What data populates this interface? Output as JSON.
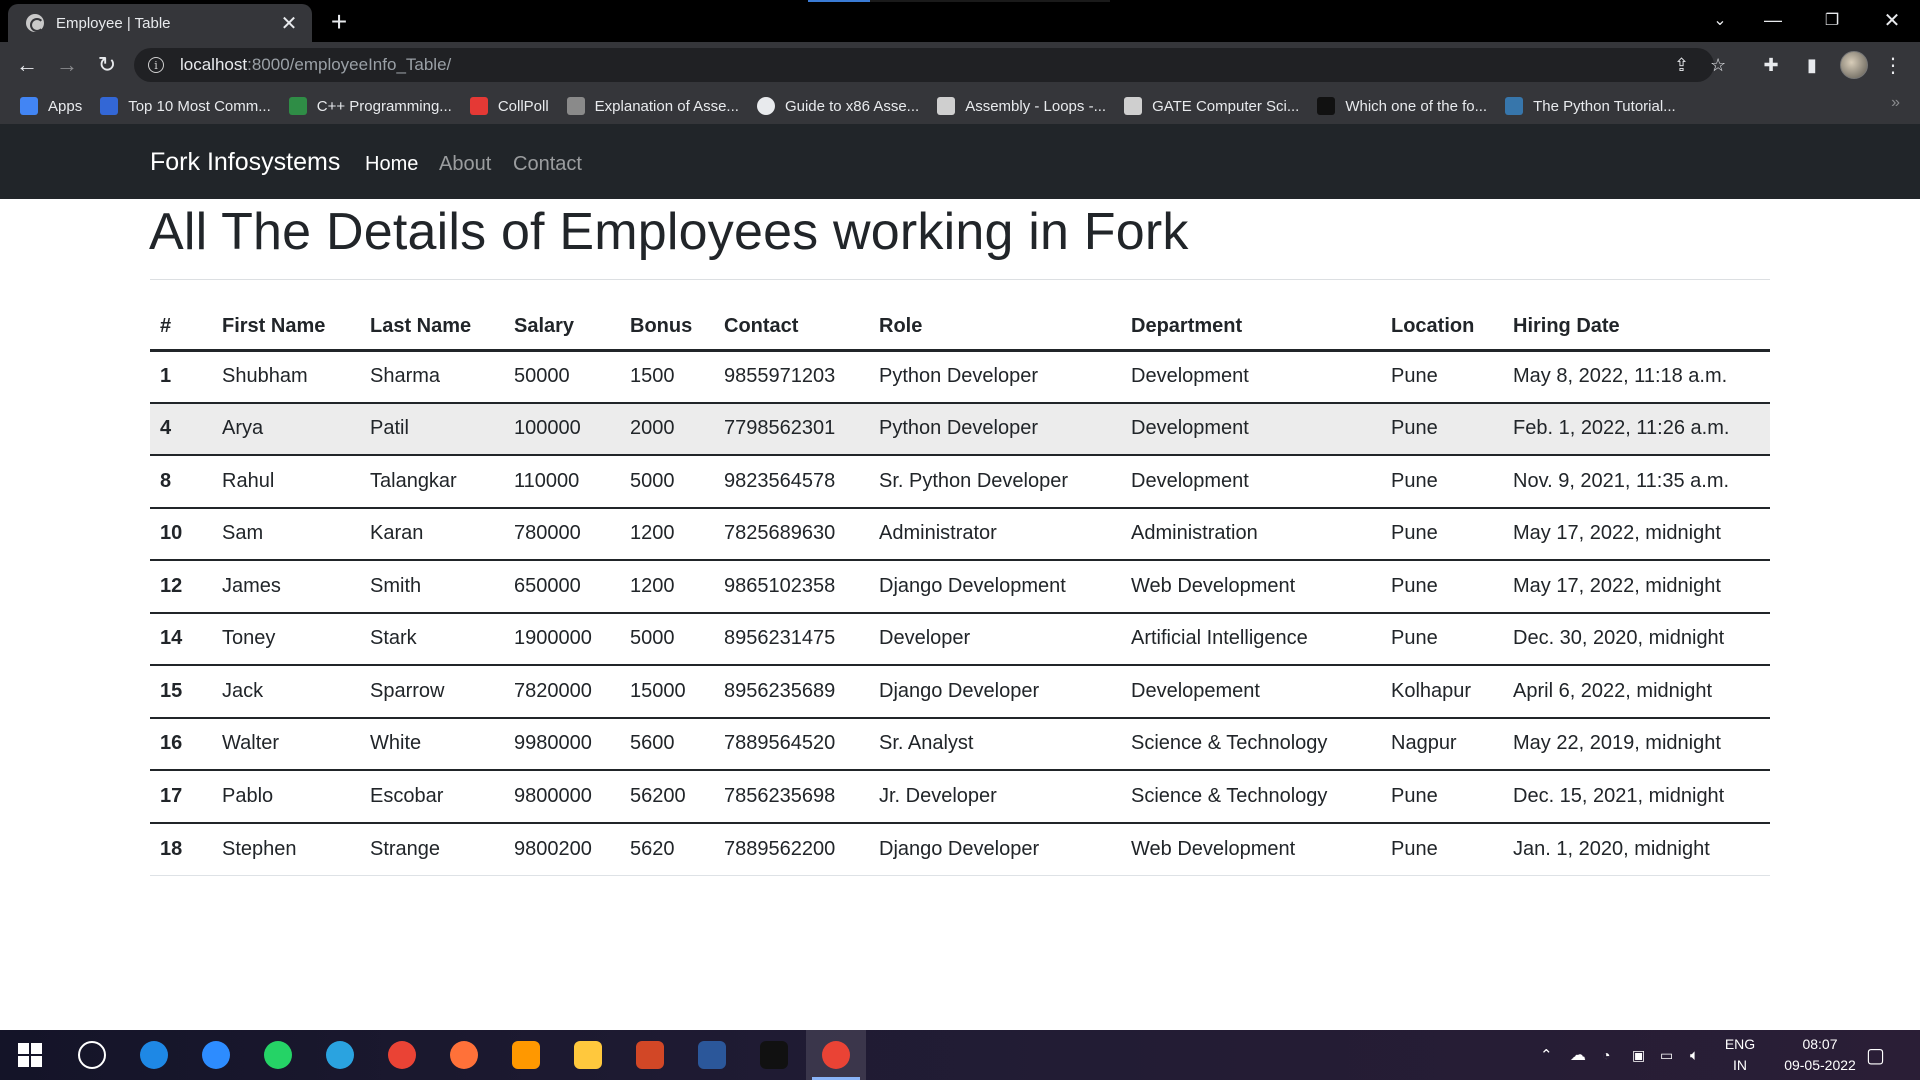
{
  "browser": {
    "tab_title": "Employee | Table",
    "new_tab": "+",
    "url_host": "localhost",
    "url_rest": ":8000/employeeInfo_Table/",
    "bookmarks": [
      {
        "label": "Apps",
        "icon": "apps-grid-icon",
        "color": "#4285f4"
      },
      {
        "label": "Top 10 Most Comm...",
        "icon": "bookmark-favicon",
        "color": "#3367d6"
      },
      {
        "label": "C++ Programming...",
        "icon": "geeks-icon",
        "color": "#2f8d46"
      },
      {
        "label": "CollPoll",
        "icon": "collpoll-icon",
        "color": "#e53935"
      },
      {
        "label": "Explanation of Asse...",
        "icon": "stackexchange-icon",
        "color": "#8a8a8a"
      },
      {
        "label": "Guide to x86 Asse...",
        "icon": "globe-icon",
        "color": "#e8eaed"
      },
      {
        "label": "Assembly - Loops -...",
        "icon": "tutorialspoint-icon",
        "color": "#cfcfcf"
      },
      {
        "label": "GATE Computer Sci...",
        "icon": "geeks-icon",
        "color": "#cfcfcf"
      },
      {
        "label": "Which one of the fo...",
        "icon": "document-icon",
        "color": "#111111"
      },
      {
        "label": "The Python Tutorial...",
        "icon": "python-icon",
        "color": "#3776ab"
      }
    ]
  },
  "navbar": {
    "brand": "Fork Infosystems",
    "links": [
      "Home",
      "About",
      "Contact"
    ]
  },
  "page": {
    "title": "All The Details of Employees working in Fork"
  },
  "table": {
    "headers": [
      "#",
      "First Name",
      "Last Name",
      "Salary",
      "Bonus",
      "Contact",
      "Role",
      "Department",
      "Location",
      "Hiring Date"
    ],
    "rows": [
      [
        "1",
        "Shubham",
        "Sharma",
        "50000",
        "1500",
        "9855971203",
        "Python Developer",
        "Development",
        "Pune",
        "May 8, 2022, 11:18 a.m."
      ],
      [
        "4",
        "Arya",
        "Patil",
        "100000",
        "2000",
        "7798562301",
        "Python Developer",
        "Development",
        "Pune",
        "Feb. 1, 2022, 11:26 a.m."
      ],
      [
        "8",
        "Rahul",
        "Talangkar",
        "110000",
        "5000",
        "9823564578",
        "Sr. Python Developer",
        "Development",
        "Pune",
        "Nov. 9, 2021, 11:35 a.m."
      ],
      [
        "10",
        "Sam",
        "Karan",
        "780000",
        "1200",
        "7825689630",
        "Administrator",
        "Administration",
        "Pune",
        "May 17, 2022, midnight"
      ],
      [
        "12",
        "James",
        "Smith",
        "650000",
        "1200",
        "9865102358",
        "Django Development",
        "Web Development",
        "Pune",
        "May 17, 2022, midnight"
      ],
      [
        "14",
        "Toney",
        "Stark",
        "1900000",
        "5000",
        "8956231475",
        "Developer",
        "Artificial Intelligence",
        "Pune",
        "Dec. 30, 2020, midnight"
      ],
      [
        "15",
        "Jack",
        "Sparrow",
        "7820000",
        "15000",
        "8956235689",
        "Django Developer",
        "Developement",
        "Kolhapur",
        "April 6, 2022, midnight"
      ],
      [
        "16",
        "Walter",
        "White",
        "9980000",
        "5600",
        "7889564520",
        "Sr. Analyst",
        "Science & Technology",
        "Nagpur",
        "May 22, 2019, midnight"
      ],
      [
        "17",
        "Pablo",
        "Escobar",
        "9800000",
        "56200",
        "7856235698",
        "Jr. Developer",
        "Science & Technology",
        "Pune",
        "Dec. 15, 2021, midnight"
      ],
      [
        "18",
        "Stephen",
        "Strange",
        "9800200",
        "5620",
        "7889562200",
        "Django Developer",
        "Web Development",
        "Pune",
        "Jan. 1, 2020, midnight"
      ]
    ],
    "hovered_row": 1
  },
  "taskbar": {
    "apps": [
      {
        "name": "start-button",
        "color": "#ffffff"
      },
      {
        "name": "dell-icon",
        "color": "#ffffff"
      },
      {
        "name": "safari-like-icon",
        "color": "#1e88e5"
      },
      {
        "name": "zoom-icon",
        "color": "#2d8cff"
      },
      {
        "name": "whatsapp-icon",
        "color": "#25d366"
      },
      {
        "name": "telegram-icon",
        "color": "#2aa3e0"
      },
      {
        "name": "chrome-icon",
        "color": "#ea4335"
      },
      {
        "name": "firefox-icon",
        "color": "#ff7139"
      },
      {
        "name": "sublime-icon",
        "color": "#ff9800"
      },
      {
        "name": "file-explorer-icon",
        "color": "#ffc83d"
      },
      {
        "name": "powerpoint-icon",
        "color": "#d24726"
      },
      {
        "name": "word-icon",
        "color": "#2b579a"
      },
      {
        "name": "terminal-icon",
        "color": "#111111"
      },
      {
        "name": "chrome-active-icon",
        "color": "#ea4335"
      }
    ],
    "lang_top": "ENG",
    "lang_bottom": "IN",
    "time": "08:07",
    "date": "09-05-2022"
  }
}
